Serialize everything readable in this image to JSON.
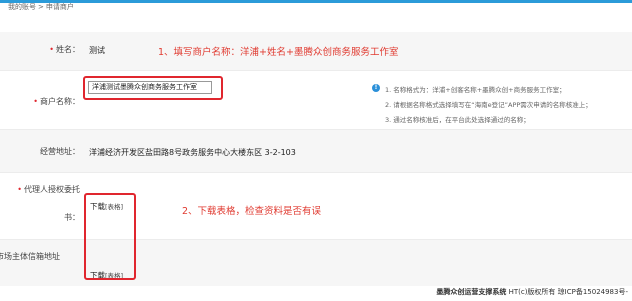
{
  "breadcrumb": {
    "items": [
      "我的账号",
      "申请商户"
    ],
    "separator": ">"
  },
  "form": {
    "name": {
      "label": "姓名：",
      "value": "测试",
      "annotation": "1、填写商户名称：洋浦+姓名+墨腾众创商务服务工作室"
    },
    "merchant": {
      "label": "商户名称：",
      "input_value": "洋浦测试墨腾众创商务服务工作室",
      "hint_icon": "info-icon",
      "hints": [
        "1. 名称格式为：洋浦+创客名称+墨腾众创+商务服务工作室；",
        "2. 请根据名称格式选择填写在“海南e登记”APP需次申请的名称核准上；",
        "3. 通过名称核准后，在平台此处选择通过的名称；"
      ]
    },
    "address": {
      "label": "经营地址：",
      "value": "洋浦经济开发区盐田路8号政务服务中心大楼东区 3-2-103"
    },
    "agent": {
      "label_line1": "代理人授权委托",
      "label_line2": "书：",
      "download_text": "下载",
      "download_tag": "[表格]",
      "annotation": "2、下载表格，检查资料是否有误"
    },
    "mailbox": {
      "label": "市场主体信箱地址",
      "download_text": "下载",
      "download_tag": "[表格]"
    }
  },
  "footer": {
    "brand": "墨腾众创运营支撑系统",
    "rest": " HT(c)版权所有 琼ICP备15024983号-"
  },
  "colors": {
    "accent": "#2b9bd9",
    "annotation_red": "#e0262e"
  }
}
